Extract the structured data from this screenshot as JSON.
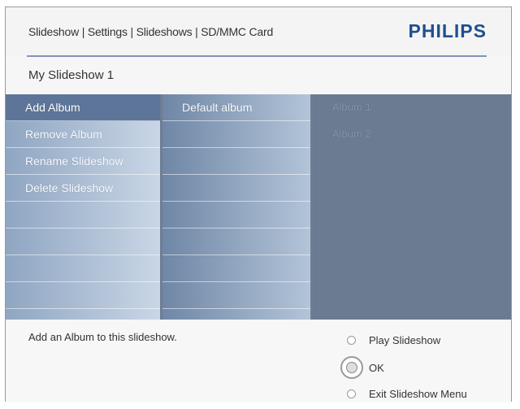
{
  "header": {
    "breadcrumb": "Slideshow | Settings | Slideshows | SD/MMC Card",
    "brand": "PHILIPS"
  },
  "subtitle": "My Slideshow 1",
  "menu": {
    "column1": [
      "Add Album",
      "Remove Album",
      "Rename Slideshow",
      "Delete Slideshow"
    ],
    "column2": [
      "Default album"
    ],
    "column3": [
      "Album 1",
      "Album 2"
    ],
    "selected": "Add Album"
  },
  "footer": {
    "hint": "Add an Album to this slideshow.",
    "options": [
      {
        "label": "Play Slideshow",
        "selected": false
      },
      {
        "label": "OK",
        "selected": true
      },
      {
        "label": "Exit Slideshow Menu",
        "selected": false
      }
    ]
  },
  "colors": {
    "brand": "#1f4f8f",
    "accent_line": "#7f96b5",
    "selected_row": "#5d7599",
    "pane_background": "#6d7d93"
  },
  "icons": {
    "option": "radio-icon",
    "ok": "ok-radio-icon"
  }
}
